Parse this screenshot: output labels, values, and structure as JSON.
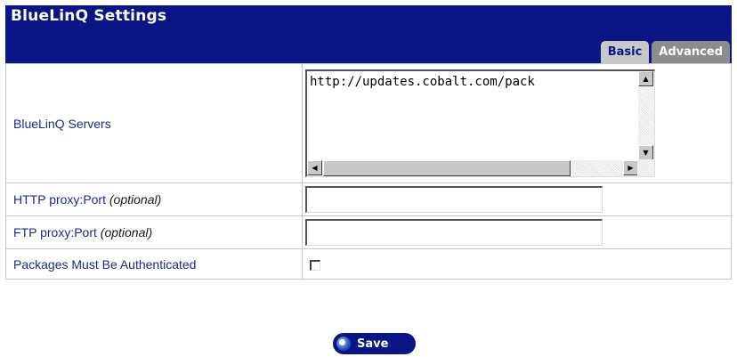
{
  "header": {
    "title": "BlueLinQ Settings",
    "tabs": [
      {
        "label": "Basic",
        "active": false
      },
      {
        "label": "Advanced",
        "active": true
      }
    ]
  },
  "rows": {
    "servers": {
      "label": "BlueLinQ Servers",
      "value": "http://updates.cobalt.com/pack"
    },
    "http_proxy": {
      "label": "HTTP proxy:Port",
      "optional": "(optional)",
      "value": ""
    },
    "ftp_proxy": {
      "label": "FTP proxy:Port",
      "optional": "(optional)",
      "value": ""
    },
    "auth": {
      "label": "Packages Must Be Authenticated",
      "checked": false
    }
  },
  "actions": {
    "save_label": "Save"
  },
  "colors": {
    "header_bg": "#0c1585",
    "label_text": "#1b2a8f",
    "tab_active_bg": "#8c8c8c",
    "tab_inactive_bg": "#c8c8c8"
  }
}
